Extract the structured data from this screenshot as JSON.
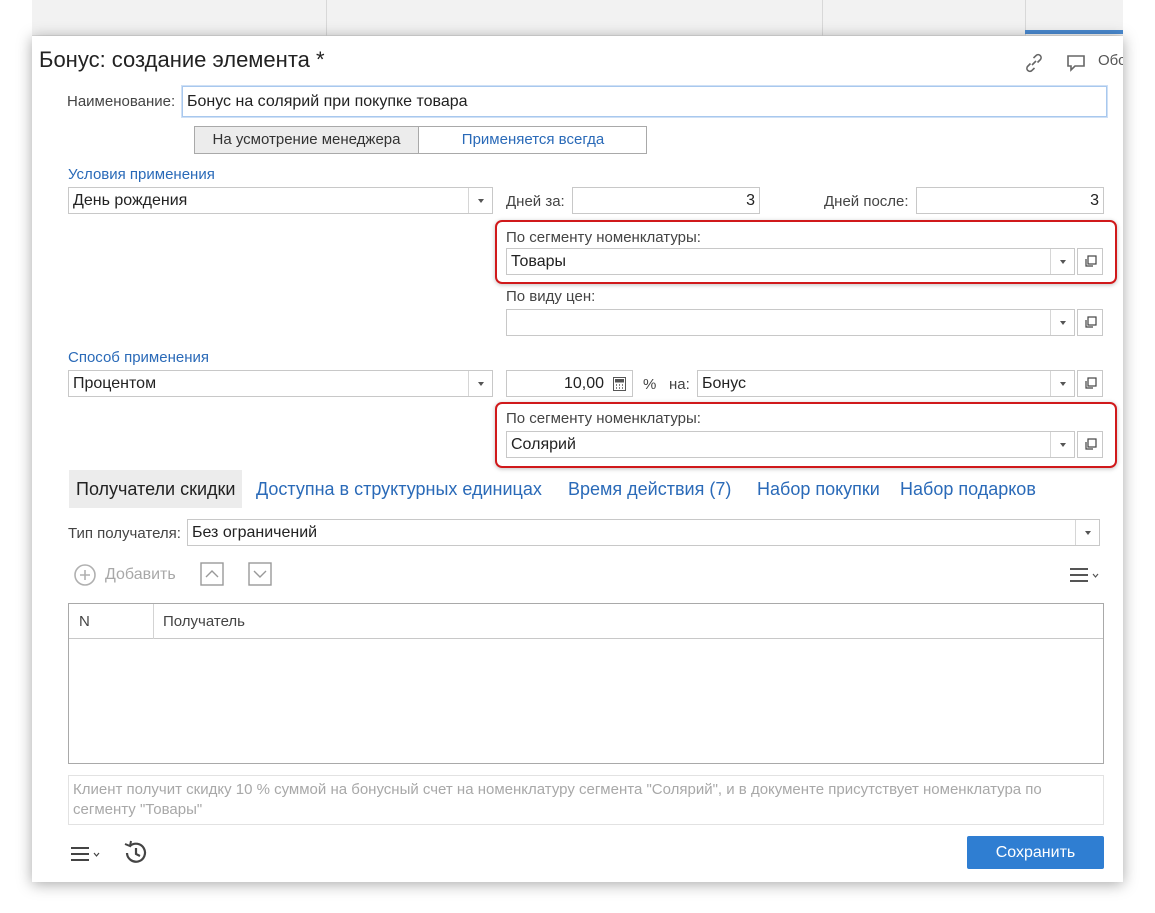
{
  "window": {
    "title": "Бонус: создание элемента *",
    "header_right_text": "Обс"
  },
  "form": {
    "name_label": "Наименование:",
    "name_value": "Бонус на солярий при покупке товара",
    "toggle": {
      "option1": "На усмотрение менеджера",
      "option2": "Применяется всегда"
    },
    "conditions": {
      "section_label": "Условия применения",
      "condition_value": "День рождения",
      "days_before_label": "Дней за:",
      "days_before_value": "3",
      "days_after_label": "Дней после:",
      "days_after_value": "3",
      "segment_label": "По сегменту номенклатуры:",
      "segment_value": "Товары",
      "price_type_label": "По виду цен:",
      "price_type_value": ""
    },
    "method": {
      "section_label": "Способ применения",
      "method_value": "Процентом",
      "amount_value": "10,00",
      "percent_label": "%",
      "on_label": "на:",
      "on_value": "Бонус",
      "segment_label": "По сегменту номенклатуры:",
      "segment_value": "Солярий"
    }
  },
  "tabs": [
    {
      "label": "Получатели скидки",
      "active": true
    },
    {
      "label": "Доступна в структурных единицах"
    },
    {
      "label": "Время действия (7)"
    },
    {
      "label": "Набор покупки"
    },
    {
      "label": "Набор подарков"
    }
  ],
  "recipients": {
    "type_label": "Тип получателя:",
    "type_value": "Без ограничений",
    "add_label": "Добавить",
    "columns": [
      "N",
      "Получатель"
    ]
  },
  "description": "Клиент получит скидку 10 % суммой на бонусный счет на номенклатуру сегмента \"Солярий\", и в документе присутствует номенклатура по сегменту \"Товары\"",
  "footer": {
    "save_label": "Сохранить"
  },
  "colors": {
    "accent": "#2f7ed2",
    "link": "#2a6ab8",
    "highlight": "#d0191b"
  }
}
